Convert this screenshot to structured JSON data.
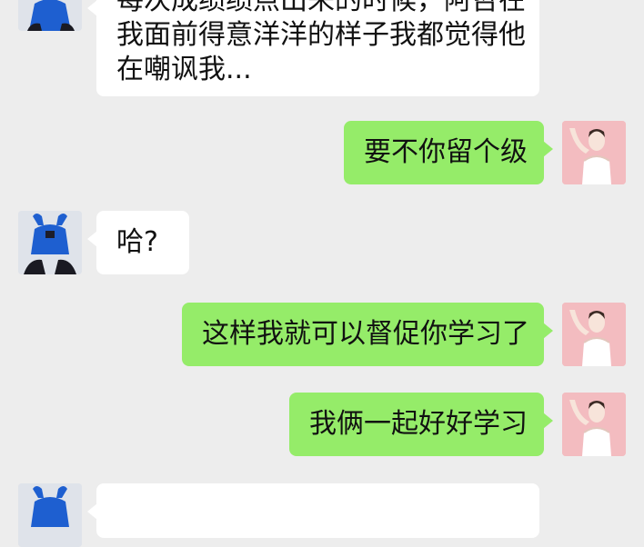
{
  "messages": [
    {
      "side": "left",
      "lines": [
        "每次成绩绩点出来的时候，阿哲在",
        "我面前得意洋洋的样子我都觉得他",
        "在嘲讽我..."
      ]
    },
    {
      "side": "right",
      "text": "要不你留个级"
    },
    {
      "side": "left",
      "text": "哈?"
    },
    {
      "side": "right",
      "text": "这样我就可以督促你学习了"
    },
    {
      "side": "right",
      "text": "我俩一起好好学习"
    },
    {
      "side": "left",
      "text": ""
    }
  ],
  "colors": {
    "background": "#ededed",
    "incoming_bubble": "#ffffff",
    "outgoing_bubble": "#95ec69",
    "contact_avatar_shirt": "#1e5fd0",
    "user_avatar_background": "#f3bcc0"
  }
}
